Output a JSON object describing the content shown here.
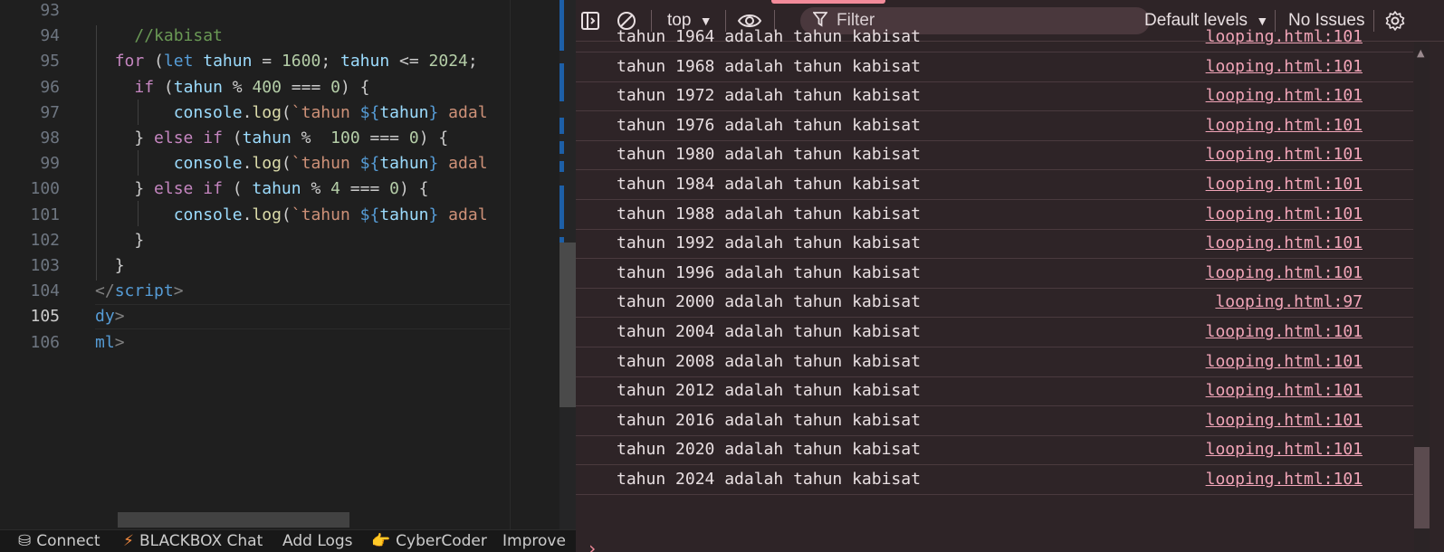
{
  "editor": {
    "lines": [
      {
        "num": "93",
        "segments": []
      },
      {
        "num": "94",
        "segments": [
          {
            "t": "    "
          },
          {
            "t": "//kabisat",
            "c": "cmt"
          }
        ]
      },
      {
        "num": "95",
        "segments": [
          {
            "t": "  "
          },
          {
            "t": "for",
            "c": "kw"
          },
          {
            "t": " ("
          },
          {
            "t": "let",
            "c": "kwb"
          },
          {
            "t": " "
          },
          {
            "t": "tahun",
            "c": "var"
          },
          {
            "t": " = "
          },
          {
            "t": "1600",
            "c": "num"
          },
          {
            "t": "; "
          },
          {
            "t": "tahun",
            "c": "var"
          },
          {
            "t": " <= "
          },
          {
            "t": "2024",
            "c": "num"
          },
          {
            "t": ";"
          }
        ]
      },
      {
        "num": "96",
        "segments": [
          {
            "t": "    "
          },
          {
            "t": "if",
            "c": "kw"
          },
          {
            "t": " ("
          },
          {
            "t": "tahun",
            "c": "var"
          },
          {
            "t": " % "
          },
          {
            "t": "400",
            "c": "num"
          },
          {
            "t": " === "
          },
          {
            "t": "0",
            "c": "num"
          },
          {
            "t": ") {"
          }
        ]
      },
      {
        "num": "97",
        "segments": [
          {
            "t": "        "
          },
          {
            "t": "console",
            "c": "var"
          },
          {
            "t": "."
          },
          {
            "t": "log",
            "c": "fn"
          },
          {
            "t": "("
          },
          {
            "t": "`tahun ",
            "c": "str"
          },
          {
            "t": "${",
            "c": "kwb"
          },
          {
            "t": "tahun",
            "c": "var"
          },
          {
            "t": "}",
            "c": "kwb"
          },
          {
            "t": " adal",
            "c": "str"
          }
        ]
      },
      {
        "num": "98",
        "segments": [
          {
            "t": "    "
          },
          {
            "t": "} "
          },
          {
            "t": "else if",
            "c": "kw"
          },
          {
            "t": " ("
          },
          {
            "t": "tahun",
            "c": "var"
          },
          {
            "t": " %  "
          },
          {
            "t": "100",
            "c": "num"
          },
          {
            "t": " === "
          },
          {
            "t": "0",
            "c": "num"
          },
          {
            "t": ") {"
          }
        ]
      },
      {
        "num": "99",
        "segments": [
          {
            "t": "        "
          },
          {
            "t": "console",
            "c": "var"
          },
          {
            "t": "."
          },
          {
            "t": "log",
            "c": "fn"
          },
          {
            "t": "("
          },
          {
            "t": "`tahun ",
            "c": "str"
          },
          {
            "t": "${",
            "c": "kwb"
          },
          {
            "t": "tahun",
            "c": "var"
          },
          {
            "t": "}",
            "c": "kwb"
          },
          {
            "t": " adal",
            "c": "str"
          }
        ]
      },
      {
        "num": "100",
        "segments": [
          {
            "t": "    "
          },
          {
            "t": "} "
          },
          {
            "t": "else if",
            "c": "kw"
          },
          {
            "t": " ( "
          },
          {
            "t": "tahun",
            "c": "var"
          },
          {
            "t": " % "
          },
          {
            "t": "4",
            "c": "num"
          },
          {
            "t": " === "
          },
          {
            "t": "0",
            "c": "num"
          },
          {
            "t": ") {"
          }
        ]
      },
      {
        "num": "101",
        "segments": [
          {
            "t": "        "
          },
          {
            "t": "console",
            "c": "var"
          },
          {
            "t": "."
          },
          {
            "t": "log",
            "c": "fn"
          },
          {
            "t": "("
          },
          {
            "t": "`tahun ",
            "c": "str"
          },
          {
            "t": "${",
            "c": "kwb"
          },
          {
            "t": "tahun",
            "c": "var"
          },
          {
            "t": "}",
            "c": "kwb"
          },
          {
            "t": " adal",
            "c": "str"
          }
        ]
      },
      {
        "num": "102",
        "segments": [
          {
            "t": "    "
          },
          {
            "t": "}"
          }
        ]
      },
      {
        "num": "103",
        "segments": [
          {
            "t": "  "
          },
          {
            "t": "}"
          }
        ]
      },
      {
        "num": "104",
        "segments": [
          {
            "t": "</",
            "c": "punct"
          },
          {
            "t": "script",
            "c": "tag"
          },
          {
            "t": ">",
            "c": "punct"
          }
        ]
      },
      {
        "num": "105",
        "active": true,
        "segments": [
          {
            "t": "dy",
            "c": "tag"
          },
          {
            "t": ">",
            "c": "punct"
          }
        ]
      },
      {
        "num": "106",
        "segments": [
          {
            "t": "ml",
            "c": "tag"
          },
          {
            "t": ">",
            "c": "punct"
          }
        ]
      }
    ]
  },
  "statusbar": {
    "items": [
      {
        "label": "Connect",
        "icon": "database-icon",
        "glyph": "⛁"
      },
      {
        "label": "BLACKBOX Chat",
        "icon": "lightning-icon",
        "glyph": "⚡"
      },
      {
        "label": "Add Logs",
        "icon": "",
        "glyph": ""
      },
      {
        "label": "CyberCoder",
        "icon": "pointing-hand-icon",
        "glyph": "👉"
      },
      {
        "label": "Improve",
        "icon": "",
        "glyph": ""
      }
    ]
  },
  "devtools": {
    "toolbar": {
      "context": "top",
      "filter_placeholder": "Filter",
      "levels": "Default levels",
      "issues": "No Issues"
    },
    "messages": [
      {
        "text": "tahun 1964 adalah tahun kabisat",
        "src": "looping.html:101",
        "partial": true
      },
      {
        "text": "tahun 1968 adalah tahun kabisat",
        "src": "looping.html:101"
      },
      {
        "text": "tahun 1972 adalah tahun kabisat",
        "src": "looping.html:101"
      },
      {
        "text": "tahun 1976 adalah tahun kabisat",
        "src": "looping.html:101"
      },
      {
        "text": "tahun 1980 adalah tahun kabisat",
        "src": "looping.html:101"
      },
      {
        "text": "tahun 1984 adalah tahun kabisat",
        "src": "looping.html:101"
      },
      {
        "text": "tahun 1988 adalah tahun kabisat",
        "src": "looping.html:101"
      },
      {
        "text": "tahun 1992 adalah tahun kabisat",
        "src": "looping.html:101"
      },
      {
        "text": "tahun 1996 adalah tahun kabisat",
        "src": "looping.html:101"
      },
      {
        "text": "tahun 2000 adalah tahun kabisat",
        "src": "looping.html:97"
      },
      {
        "text": "tahun 2004 adalah tahun kabisat",
        "src": "looping.html:101"
      },
      {
        "text": "tahun 2008 adalah tahun kabisat",
        "src": "looping.html:101"
      },
      {
        "text": "tahun 2012 adalah tahun kabisat",
        "src": "looping.html:101"
      },
      {
        "text": "tahun 2016 adalah tahun kabisat",
        "src": "looping.html:101"
      },
      {
        "text": "tahun 2020 adalah tahun kabisat",
        "src": "looping.html:101"
      },
      {
        "text": "tahun 2024 adalah tahun kabisat",
        "src": "looping.html:101"
      }
    ],
    "prompt_glyph": "›"
  }
}
